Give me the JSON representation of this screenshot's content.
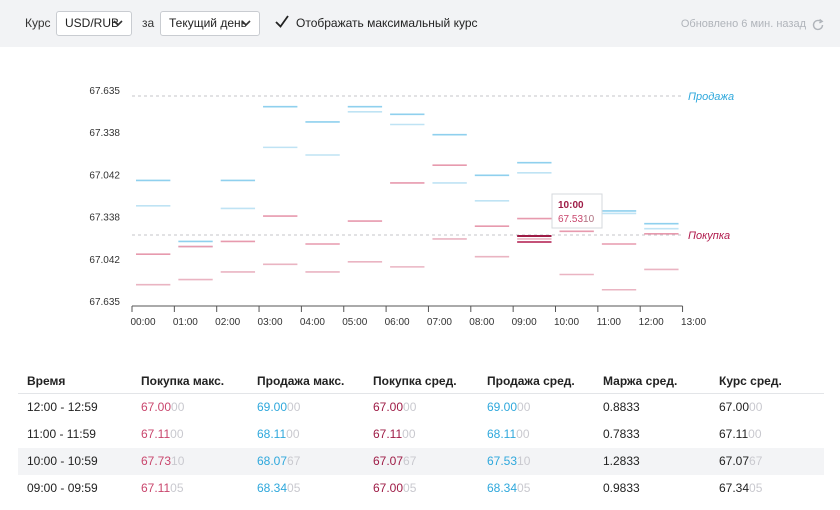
{
  "toolbar": {
    "rate_label": "Курс",
    "currency_pair": "USD/RUB",
    "for_label": "за",
    "period": "Текущий день",
    "show_max_label": "Отображать максимальный курс",
    "show_max_checked": true,
    "updated_text": "Обновлено 6 мин. назад"
  },
  "chart_data": {
    "type": "line",
    "x": [
      "00:00",
      "01:00",
      "02:00",
      "03:00",
      "04:00",
      "05:00",
      "06:00",
      "07:00",
      "08:00",
      "09:00",
      "10:00",
      "11:00",
      "12:00",
      "13:00"
    ],
    "y_tick_labels": [
      "67.635",
      "67.338",
      "67.042",
      "67.338",
      "67.042",
      "67.635"
    ],
    "series": [
      {
        "name": "Продажа",
        "color": "#2fa8dc",
        "max": [
          67.34,
          67.1,
          67.34,
          67.63,
          67.57,
          67.63,
          67.6,
          67.52,
          67.36,
          67.41,
          67.27,
          67.22,
          67.17
        ],
        "avg": [
          67.24,
          67.08,
          67.23,
          67.47,
          67.44,
          67.61,
          67.56,
          67.33,
          67.26,
          67.37,
          67.25,
          67.21,
          67.15
        ]
      },
      {
        "name": "Покупка",
        "color": "#c9466d",
        "max": [
          67.05,
          67.08,
          67.1,
          67.2,
          67.09,
          67.18,
          67.33,
          67.4,
          67.16,
          67.19,
          67.14,
          67.09,
          67.13
        ],
        "avg": [
          66.93,
          66.95,
          66.98,
          67.01,
          66.98,
          67.02,
          67.0,
          67.11,
          67.04,
          67.11,
          66.97,
          66.91,
          66.99
        ]
      }
    ],
    "reference_lines": [
      {
        "label": "Продажа",
        "color": "#2fa8dc"
      },
      {
        "label": "Покупка",
        "color": "#b0194b"
      }
    ],
    "tooltip": {
      "time": "10:00",
      "value_main": "67.53",
      "value_tail": "10"
    },
    "grid": false,
    "legend": "right"
  },
  "table": {
    "headers": [
      "Время",
      "Покупка макс.",
      "Продажа макс.",
      "Покупка сред.",
      "Продажа сред.",
      "Маржа сред.",
      "Курс сред."
    ],
    "rows": [
      {
        "time": "12:00 - 12:59",
        "buy_max": [
          "67.00",
          "00"
        ],
        "sell_max": [
          "69.00",
          "00"
        ],
        "buy_avg": [
          "67.00",
          "00"
        ],
        "sell_avg": [
          "69.00",
          "00"
        ],
        "margin": "0.8833",
        "rate": [
          "67.00",
          "00"
        ]
      },
      {
        "time": "11:00 - 11:59",
        "buy_max": [
          "67.11",
          "00"
        ],
        "sell_max": [
          "68.11",
          "00"
        ],
        "buy_avg": [
          "67.11",
          "00"
        ],
        "sell_avg": [
          "68.11",
          "00"
        ],
        "margin": "0.7833",
        "rate": [
          "67.11",
          "00"
        ]
      },
      {
        "time": "10:00 - 10:59",
        "buy_max": [
          "67.73",
          "10"
        ],
        "sell_max": [
          "68.07",
          "67"
        ],
        "buy_avg": [
          "67.07",
          "67"
        ],
        "sell_avg": [
          "67.53",
          "10"
        ],
        "margin": "1.2833",
        "rate": [
          "67.07",
          "67"
        ]
      },
      {
        "time": "09:00 - 09:59",
        "buy_max": [
          "67.11",
          "05"
        ],
        "sell_max": [
          "68.34",
          "05"
        ],
        "buy_avg": [
          "67.00",
          "05"
        ],
        "sell_avg": [
          "68.34",
          "05"
        ],
        "margin": "0.9833",
        "rate": [
          "67.34",
          "05"
        ]
      }
    ]
  }
}
